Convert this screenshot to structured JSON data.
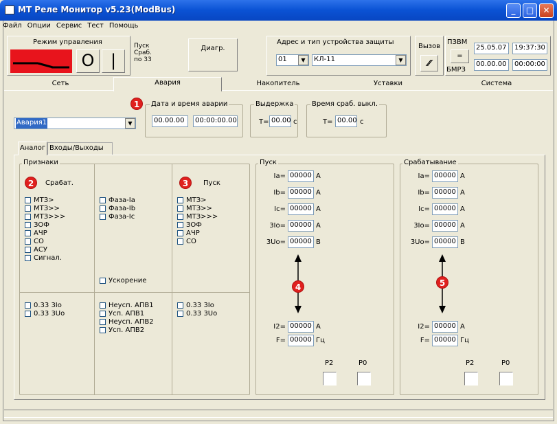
{
  "window": {
    "title": "МТ Реле Монитор v5.23(ModBus)",
    "min": "_",
    "max": "□",
    "close": "✕"
  },
  "menu": [
    "Файл",
    "Опции",
    "Сервис",
    "Тест",
    "Помощь"
  ],
  "control": {
    "mode_label": "Режим управления",
    "btn_off": "O",
    "btn_on": "|",
    "pusk": "Пуск",
    "srab": "Сраб.",
    "po33": "по 33",
    "diag": "Диагр."
  },
  "address": {
    "group_title": "Адрес и тип устройства защиты",
    "addr": "01",
    "type": "КЛ-11",
    "call_btn": "Вызов",
    "call_icon": "⁄⁄"
  },
  "pzvm": {
    "label1": "ПЗВМ",
    "equals": "=",
    "label2": "БМРЗ",
    "date1": "25.05.07",
    "time1": "19:37:30",
    "date2": "00.00.00",
    "time2": "00:00:00"
  },
  "tabs": [
    "Сеть",
    "Авария",
    "Накопитель",
    "Уставки",
    "Система"
  ],
  "alarm": {
    "select": "Авария1",
    "dt_title": "Дата и время аварии",
    "date": "00.00.00",
    "time": "00:00:00.00",
    "hold_title": "Выдержка",
    "hold_t": "T=",
    "hold_val": "00.00",
    "hold_unit": "c",
    "trip_title": "Время сраб. выкл.",
    "trip_t": "T=",
    "trip_val": "00.00",
    "trip_unit": "c"
  },
  "subtabs": [
    "Аналог",
    "Входы/Выходы"
  ],
  "signs": {
    "title": "Признаки",
    "col1_head": "Сра6ат.",
    "col3_head": "Пуск",
    "col1": [
      "МТЗ>",
      "МТЗ>>",
      "МТЗ>>>",
      "ЗОФ",
      "АЧР",
      "СО",
      "АСУ",
      "Сигнал."
    ],
    "col2": [
      "Фаза-Iа",
      "Фаза-Ib",
      "Фаза-Ic"
    ],
    "col2_accel": "Ускорение",
    "col3": [
      "МТЗ>",
      "МТЗ>>",
      "МТЗ>>>",
      "ЗОФ",
      "АЧР",
      "СО"
    ],
    "b1": [
      "0.33 3Io",
      "0.33 3Uo"
    ],
    "b2": [
      "Неусп. АПВ1",
      "Усп. АПВ1",
      "Неусп. АПВ2",
      "Усп. АПВ2"
    ],
    "b3": [
      "0.33 3Io",
      "0.33 3Uo"
    ]
  },
  "pusk": {
    "title": "Пуск",
    "rows": [
      {
        "l": "Iа=",
        "v": "00000",
        "u": "А"
      },
      {
        "l": "Ib=",
        "v": "00000",
        "u": "А"
      },
      {
        "l": "Ic=",
        "v": "00000",
        "u": "А"
      },
      {
        "l": "3Io=",
        "v": "00000",
        "u": "А"
      },
      {
        "l": "3Uo=",
        "v": "00000",
        "u": "В"
      }
    ],
    "i2": {
      "l": "I2=",
      "v": "00000",
      "u": "А"
    },
    "f": {
      "l": "F=",
      "v": "00000",
      "u": "Гц"
    },
    "p2": "P2",
    "p0": "P0"
  },
  "srab": {
    "title": "Срабатывание",
    "rows": [
      {
        "l": "Iа=",
        "v": "00000",
        "u": "А"
      },
      {
        "l": "Ib=",
        "v": "00000",
        "u": "А"
      },
      {
        "l": "Ic=",
        "v": "00000",
        "u": "А"
      },
      {
        "l": "3Io=",
        "v": "00000",
        "u": "А"
      },
      {
        "l": "3Uo=",
        "v": "00000",
        "u": "В"
      }
    ],
    "i2": {
      "l": "I2=",
      "v": "00000",
      "u": "А"
    },
    "f": {
      "l": "F=",
      "v": "00000",
      "u": "Гц"
    },
    "p2": "P2",
    "p0": "P0"
  },
  "badges": [
    "1",
    "2",
    "3",
    "4",
    "5"
  ],
  "colors": {
    "title_blue": "#0a52d4",
    "badge_red": "#e0201e",
    "switch_red": "#e8141c"
  }
}
